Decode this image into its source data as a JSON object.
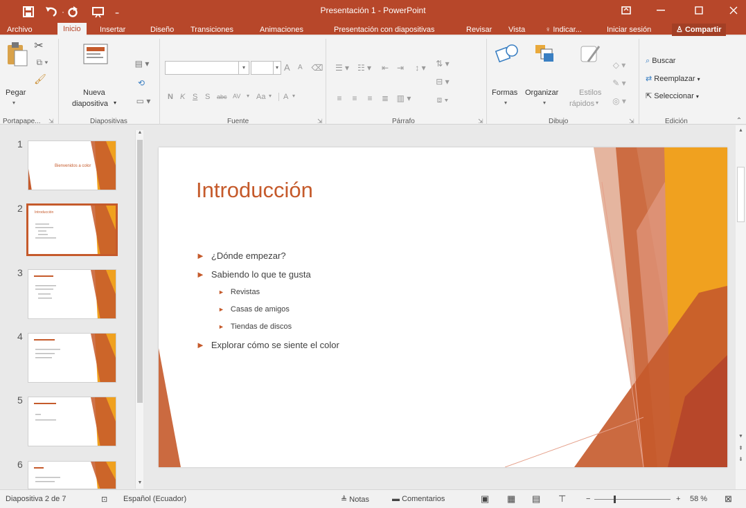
{
  "colors": {
    "accent": "#b7472a",
    "slide_accent": "#c55a2b",
    "orange": "#f0a11f"
  },
  "window": {
    "title": "Presentación 1 - PowerPoint"
  },
  "quick_access": {
    "save_icon": "save-icon",
    "undo_icon": "undo-icon",
    "redo_icon": "redo-icon",
    "start_icon": "start-from-beginning-icon"
  },
  "tabs": [
    "Archivo",
    "Inicio",
    "Insertar",
    "Diseño",
    "Transiciones",
    "Animaciones",
    "Presentación con diapositivas",
    "Revisar",
    "Vista"
  ],
  "tell_me": "Indicar...",
  "signin": "Iniciar sesión",
  "share": "Compartir",
  "ribbon": {
    "clipboard": {
      "paste": "Pegar",
      "group": "Portapape..."
    },
    "slides": {
      "new_slide_1": "Nueva",
      "new_slide_2": "diapositiva",
      "group": "Diapositivas"
    },
    "font": {
      "bold": "N",
      "italic": "K",
      "underline": "S",
      "shadow": "S",
      "strike": "abc",
      "spacing": "AV",
      "case": "Aa",
      "color": "A",
      "grow": "A",
      "shrink": "A",
      "group": "Fuente"
    },
    "paragraph": {
      "group": "Párrafo"
    },
    "drawing": {
      "shapes": "Formas",
      "arrange": "Organizar",
      "quick_styles_1": "Estilos",
      "quick_styles_2": "rápidos",
      "group": "Dibujo"
    },
    "editing": {
      "find": "Buscar",
      "replace": "Reemplazar",
      "select": "Seleccionar",
      "group": "Edición"
    }
  },
  "thumbnails": [
    {
      "num": "1",
      "title": "Bienvenidos a color"
    },
    {
      "num": "2",
      "title": "Introducción"
    },
    {
      "num": "3",
      "title": ""
    },
    {
      "num": "4",
      "title": ""
    },
    {
      "num": "5",
      "title": ""
    },
    {
      "num": "6",
      "title": ""
    }
  ],
  "slide": {
    "title": "Introducción",
    "bullets": [
      {
        "text": "¿Dónde empezar?",
        "level": 1
      },
      {
        "text": "Sabiendo lo que te gusta",
        "level": 1
      },
      {
        "text": "Revistas",
        "level": 2
      },
      {
        "text": "Casas de amigos",
        "level": 2
      },
      {
        "text": "Tiendas de discos",
        "level": 2
      },
      {
        "text": "Explorar cómo se siente el color",
        "level": 1
      }
    ]
  },
  "status": {
    "slide_count": "Diapositiva 2 de 7",
    "language": "Español (Ecuador)",
    "notes": "Notas",
    "comments": "Comentarios",
    "zoom": "58 %",
    "zoom_value": 0.58
  }
}
